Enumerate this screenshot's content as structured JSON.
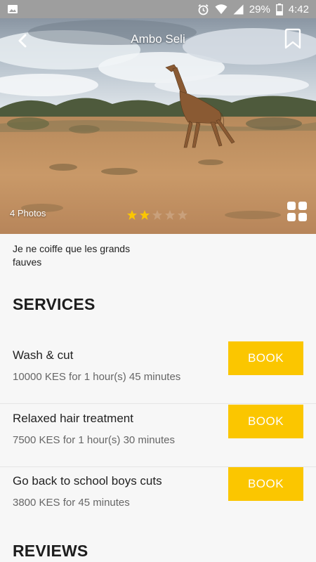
{
  "status_bar": {
    "battery": "29%",
    "time": "4:42"
  },
  "header": {
    "title": "Ambo Seli"
  },
  "hero": {
    "photos_label": "4 Photos",
    "rating": 2,
    "max_rating": 5
  },
  "description": "Je ne coiffe que les grands fauves",
  "services": {
    "title": "SERVICES",
    "items": [
      {
        "name": "Wash & cut",
        "meta": "10000 KES for 1 hour(s) 45 minutes",
        "button": "BOOK"
      },
      {
        "name": "Relaxed hair treatment",
        "meta": "7500 KES for 1 hour(s) 30 minutes",
        "button": "BOOK"
      },
      {
        "name": "Go back to school boys cuts",
        "meta": "3800 KES for 45 minutes",
        "button": "BOOK"
      }
    ]
  },
  "reviews": {
    "title": "REVIEWS"
  },
  "colors": {
    "accent": "#fbc600",
    "status_bar": "#9e9e9e",
    "background": "#f7f7f7"
  },
  "icons": [
    "image-icon",
    "alarm-icon",
    "wifi-icon",
    "signal-icon",
    "battery-icon",
    "back-arrow-icon",
    "bookmark-icon",
    "star-icon",
    "grid-icon"
  ]
}
